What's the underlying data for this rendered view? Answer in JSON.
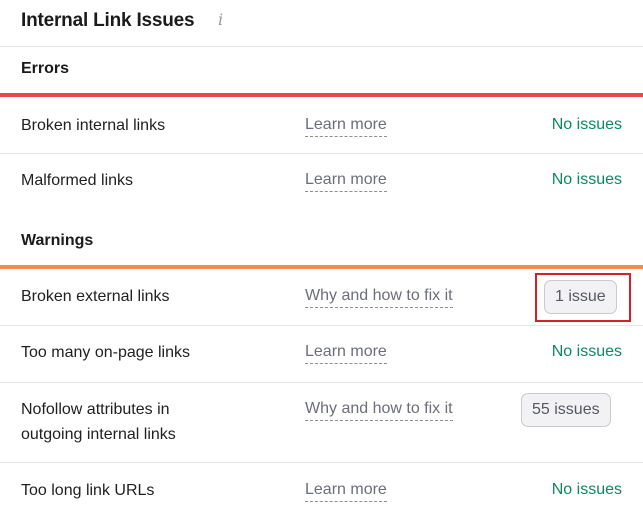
{
  "header": {
    "title": "Internal Link Issues",
    "info_glyph": "i"
  },
  "sections": {
    "errors": {
      "label": "Errors",
      "color": "#e5484d"
    },
    "warnings": {
      "label": "Warnings",
      "color": "#f48c47"
    }
  },
  "rows": [
    {
      "name": "Broken internal links",
      "link": "Learn more",
      "status": "No issues"
    },
    {
      "name": "Malformed links",
      "link": "Learn more",
      "status": "No issues"
    },
    {
      "name": "Broken external links",
      "link": "Why and how to fix it",
      "status": "1 issue",
      "highlighted": true
    },
    {
      "name": "Too many on-page links",
      "link": "Learn more",
      "status": "No issues"
    },
    {
      "name_line1": "Nofollow attributes in",
      "name_line2": "outgoing internal links",
      "link": "Why and how to fix it",
      "status": "55 issues"
    },
    {
      "name": "Too long link URLs",
      "link": "Learn more",
      "status": "No issues"
    }
  ],
  "colors": {
    "ok": "#0c8a5d",
    "highlight": "#d3222a"
  }
}
